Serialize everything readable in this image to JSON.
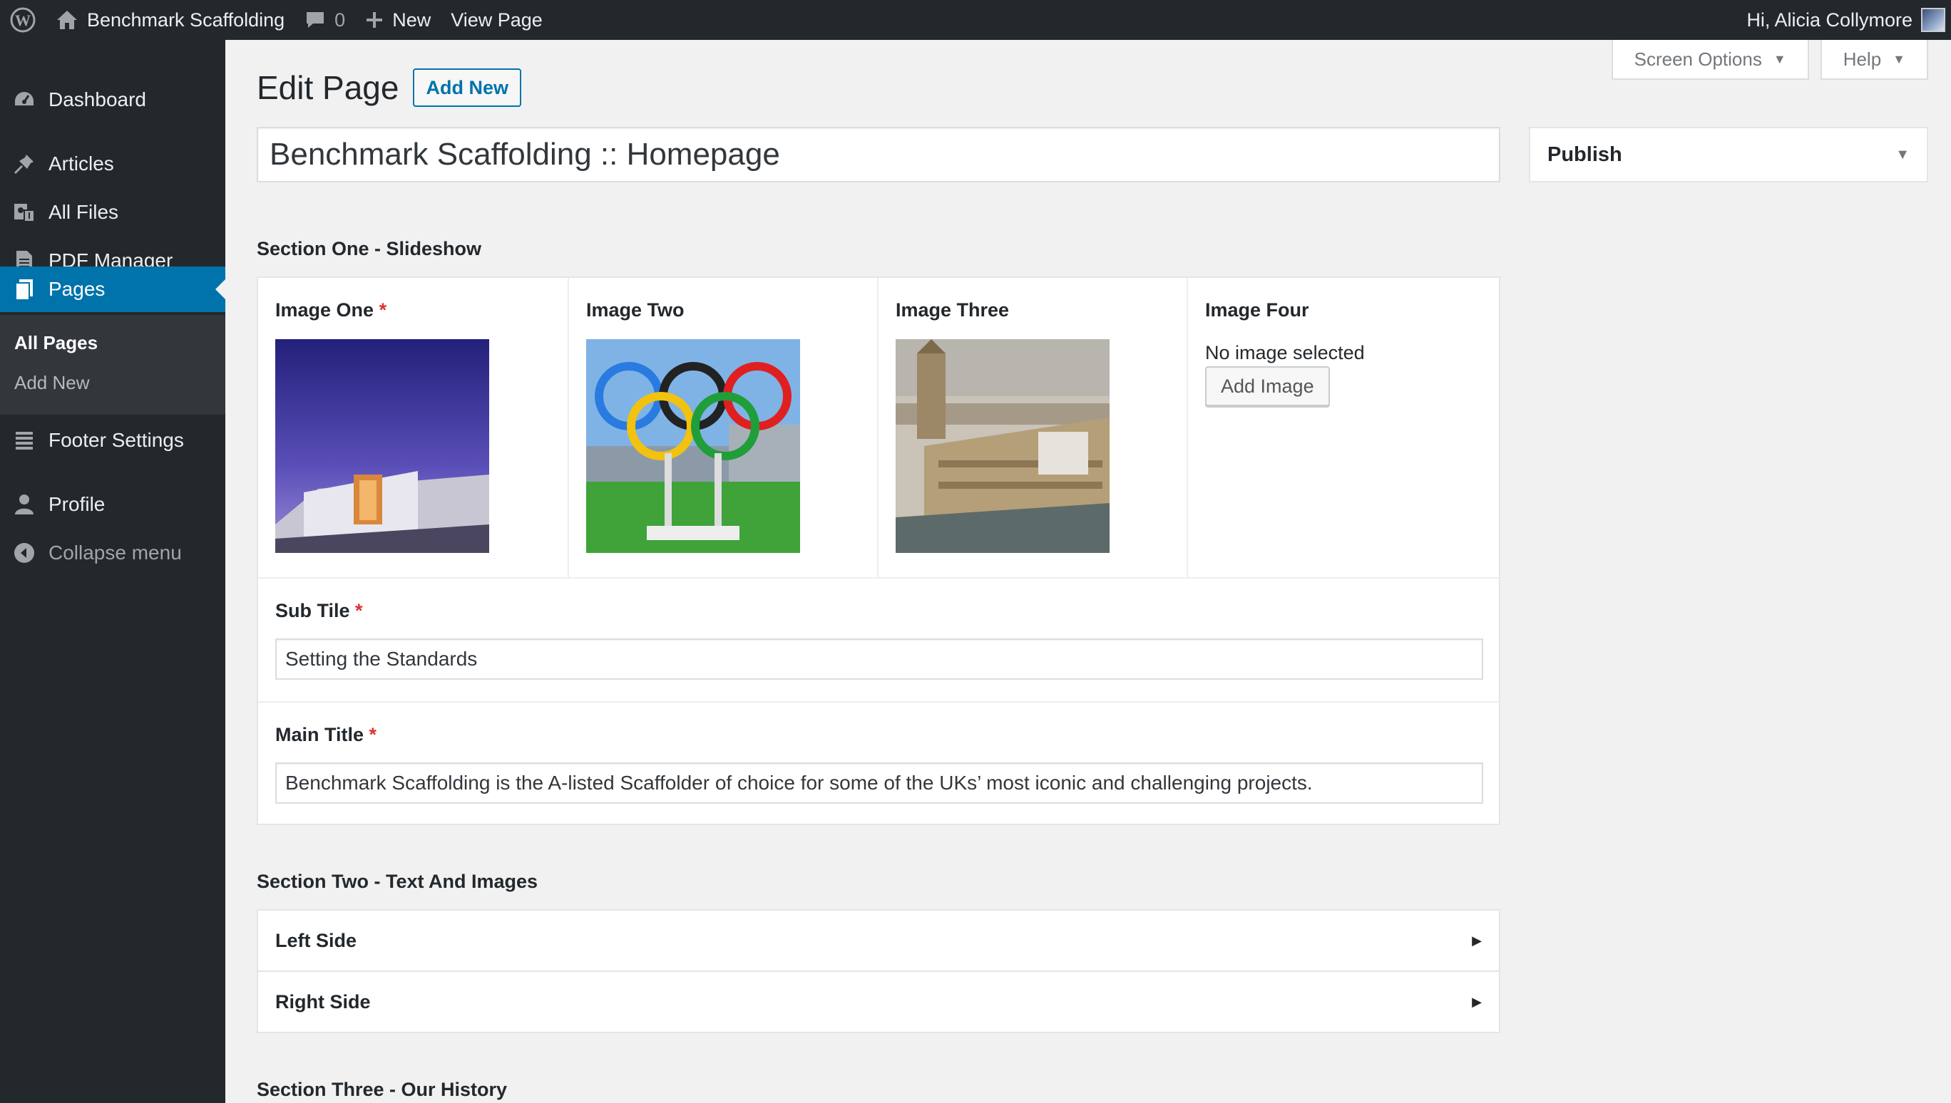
{
  "admin_bar": {
    "site_name": "Benchmark Scaffolding",
    "comments_count": "0",
    "new_label": "New",
    "view_page_label": "View Page",
    "greeting": "Hi, Alicia Collymore",
    "icons": [
      "wordpress-logo-icon",
      "home-icon",
      "comment-icon",
      "plus-icon",
      "avatar"
    ]
  },
  "sidebar": {
    "items": [
      {
        "label": "Dashboard",
        "icon": "dashboard-icon"
      },
      {
        "label": "Articles",
        "icon": "pin-icon"
      },
      {
        "label": "All Files",
        "icon": "media-icon"
      },
      {
        "label": "PDF Manager",
        "icon": "document-icon"
      },
      {
        "label": "Pages",
        "icon": "pages-icon",
        "current": true
      },
      {
        "label": "Footer Settings",
        "icon": "list-icon"
      },
      {
        "label": "Profile",
        "icon": "user-icon"
      },
      {
        "label": "Collapse menu",
        "icon": "collapse-icon"
      }
    ],
    "submenu": [
      {
        "label": "All Pages",
        "current": true
      },
      {
        "label": "Add New"
      }
    ]
  },
  "screen_meta": {
    "screen_options": "Screen Options",
    "help": "Help"
  },
  "page": {
    "heading": "Edit Page",
    "add_new": "Add New",
    "title_value": "Benchmark Scaffolding :: Homepage"
  },
  "publish": {
    "title": "Publish"
  },
  "section_one": {
    "heading": "Section One - Slideshow",
    "images": [
      {
        "label": "Image One",
        "required": "*",
        "thumb": "building-at-dusk"
      },
      {
        "label": "Image Two",
        "thumb": "olympic-rings"
      },
      {
        "label": "Image Three",
        "thumb": "houses-of-parliament"
      },
      {
        "label": "Image Four",
        "empty_text": "No image selected",
        "button": "Add Image"
      }
    ],
    "sub_title": {
      "label": "Sub Tile",
      "required": "*",
      "value": "Setting the Standards"
    },
    "main_title": {
      "label": "Main Title",
      "required": "*",
      "value": "Benchmark Scaffolding is the A-listed Scaffolder of choice for some of the UKs’ most iconic and challenging projects."
    }
  },
  "section_two": {
    "heading": "Section Two - Text And Images",
    "panels": [
      "Left Side",
      "Right Side"
    ]
  },
  "section_three": {
    "heading": "Section Three - Our History"
  },
  "colors": {
    "admin_dark": "#23282d",
    "accent": "#0073aa",
    "background": "#f1f1f1",
    "required": "#dc3232"
  }
}
